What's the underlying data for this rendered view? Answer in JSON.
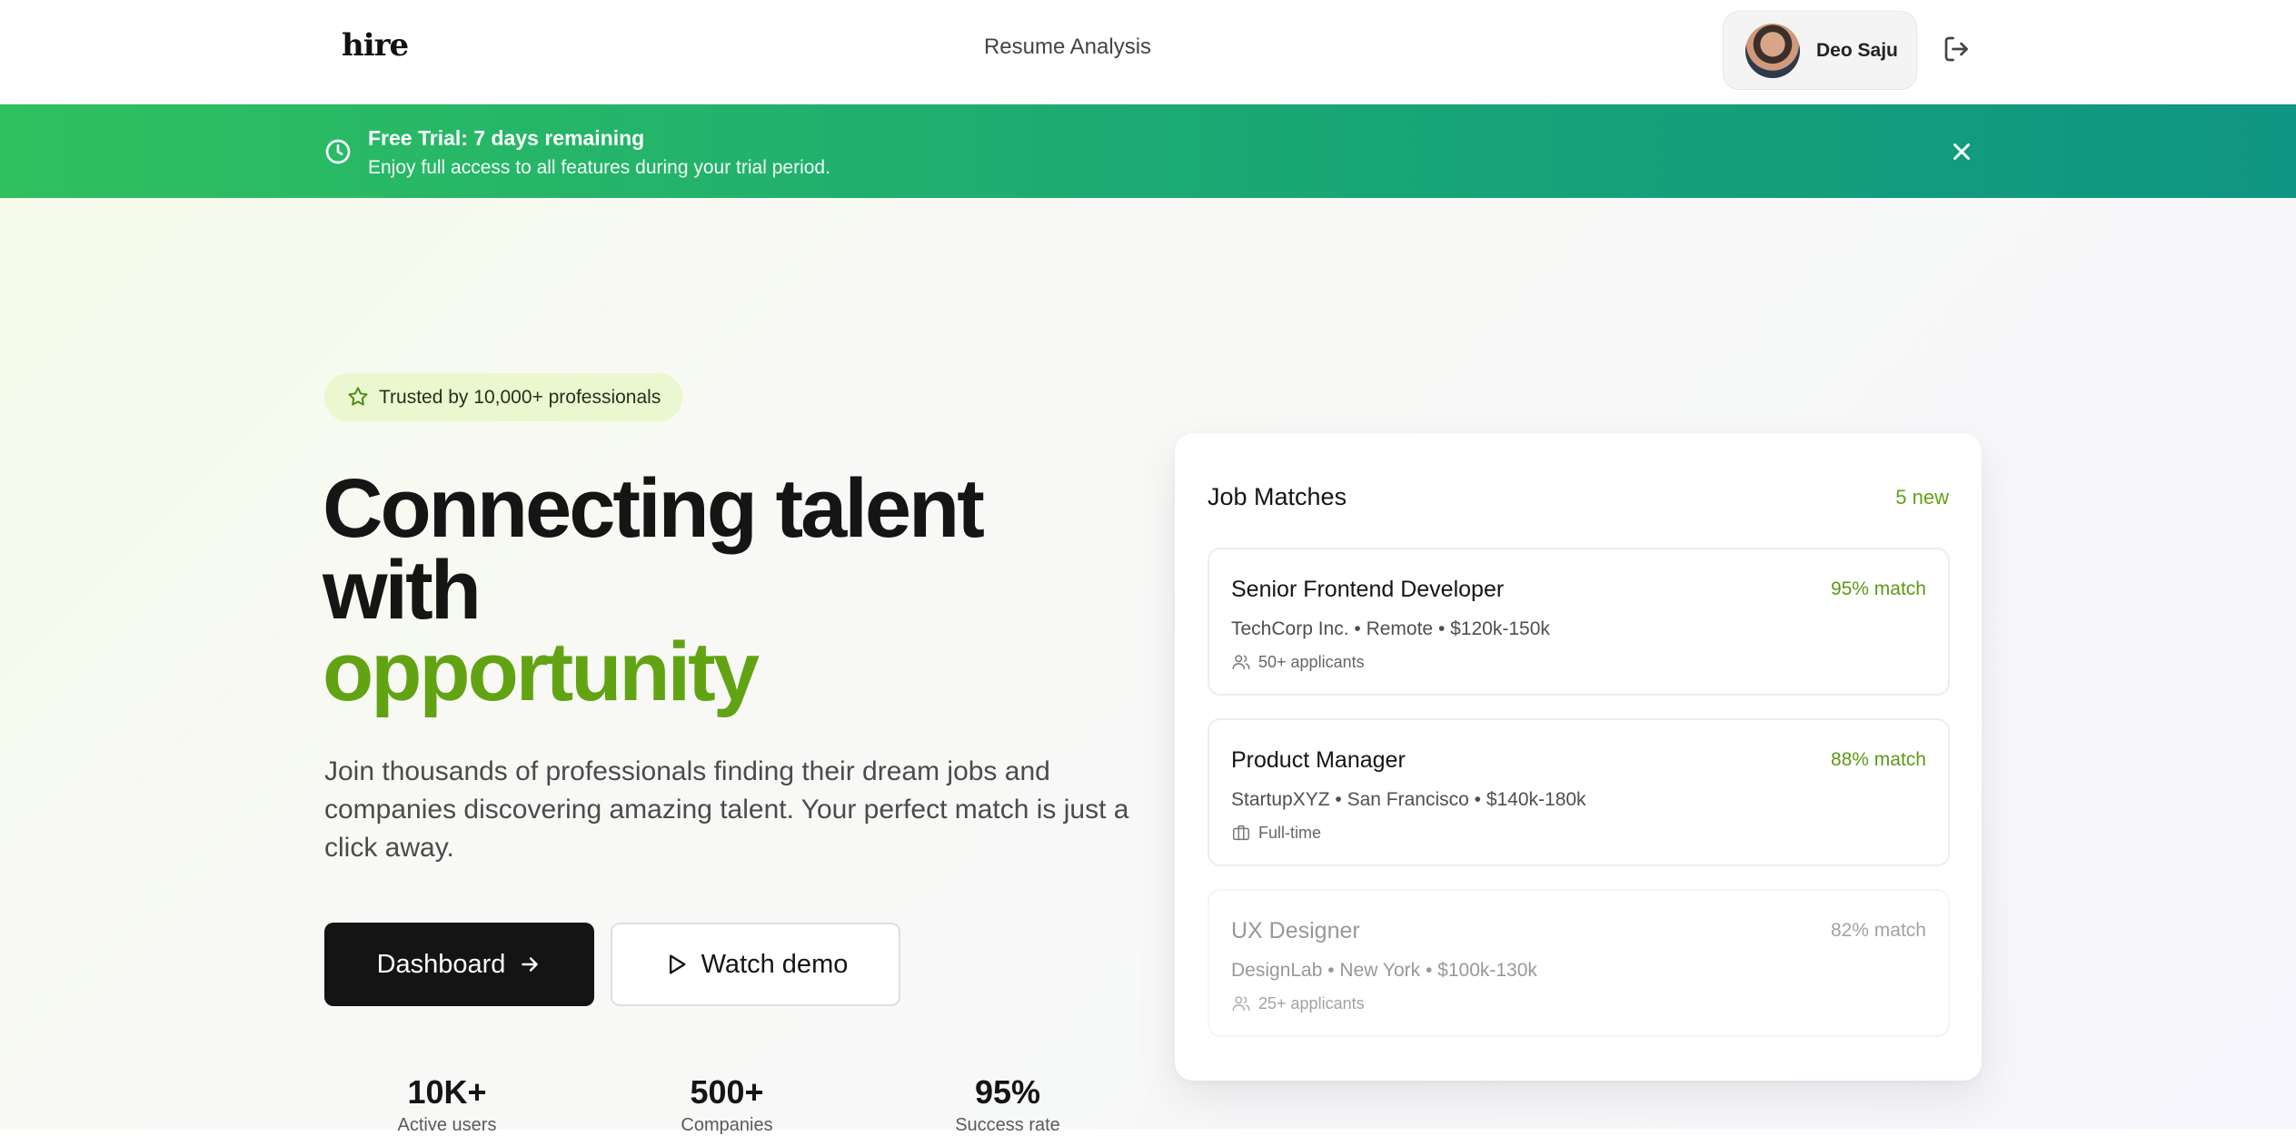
{
  "header": {
    "logo": "hire",
    "nav_link": "Resume Analysis",
    "user_name": "Deo Saju"
  },
  "banner": {
    "title_prefix": "Free Trial: ",
    "title_strong": "7 days remaining",
    "subtitle": "Enjoy full access to all features during your trial period."
  },
  "hero": {
    "badge": "Trusted by 10,000+ professionals",
    "headline_line1": "Connecting talent",
    "headline_line2": "with",
    "headline_accent": "opportunity",
    "subtext": "Join thousands of professionals finding their dream jobs and companies discovering amazing talent. Your perfect match is just a click away.",
    "primary_button": "Dashboard",
    "secondary_button": "Watch demo",
    "stats": [
      {
        "value": "10K+",
        "label": "Active users"
      },
      {
        "value": "500+",
        "label": "Companies"
      },
      {
        "value": "95%",
        "label": "Success rate"
      }
    ]
  },
  "job_matches": {
    "title": "Job Matches",
    "new_count": "5 new",
    "jobs": [
      {
        "title": "Senior Frontend Developer",
        "match": "95% match",
        "meta": "TechCorp Inc. • Remote • $120k-150k",
        "extra": "50+ applicants",
        "extra_icon": "users-icon"
      },
      {
        "title": "Product Manager",
        "match": "88% match",
        "meta": "StartupXYZ • San Francisco • $140k-180k",
        "extra": "Full-time",
        "extra_icon": "briefcase-icon"
      },
      {
        "title": "UX Designer",
        "match": "82% match",
        "meta": "DesignLab • New York • $100k-130k",
        "extra": "25+ applicants",
        "extra_icon": "users-icon"
      }
    ]
  },
  "colors": {
    "accent_green": "#62a313",
    "banner_start": "#2fc05f",
    "banner_end": "#0f9583",
    "primary_button": "#141414"
  }
}
